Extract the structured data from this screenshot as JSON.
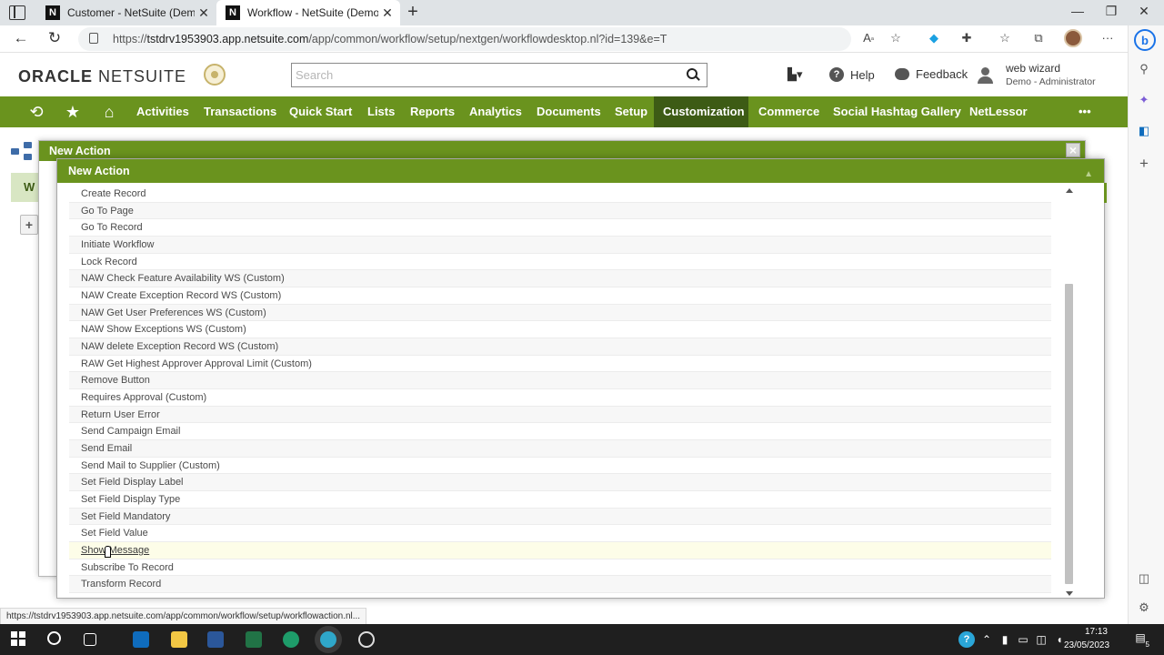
{
  "browser": {
    "tabs": [
      {
        "title": "Customer - NetSuite (Demo)",
        "favicon": "N"
      },
      {
        "title": "Workflow - NetSuite (Demo)",
        "favicon": "N"
      }
    ],
    "url_prefix": "https://",
    "url_host": "tstdrv1953903.app.netsuite.com",
    "url_path": "/app/common/workflow/setup/nextgen/workflowdesktop.nl?id=139&e=T",
    "bing_label": "b"
  },
  "header": {
    "logo_oracle": "ORACLE",
    "logo_netsuite": "NETSUITE",
    "search_placeholder": "Search",
    "help_label": "Help",
    "feedback_label": "Feedback",
    "user_name": "web wizard",
    "user_role": "Demo - Administrator"
  },
  "nav": {
    "items": [
      "Activities",
      "Transactions",
      "Quick Start",
      "Lists",
      "Reports",
      "Analytics",
      "Documents",
      "Setup",
      "Customization",
      "Commerce",
      "Social Hashtag Gallery",
      "NetLessor"
    ],
    "active": "Customization",
    "more": "•••"
  },
  "background": {
    "strip_letter": "W",
    "plus": "+"
  },
  "modal_outer": {
    "title": "New Action",
    "close": "×"
  },
  "modal_inner": {
    "title": "New Action",
    "collapse": "▲",
    "actions": [
      "Create Record",
      "Go To Page",
      "Go To Record",
      "Initiate Workflow",
      "Lock Record",
      "NAW Check Feature Availability WS (Custom)",
      "NAW Create Exception Record WS (Custom)",
      "NAW Get User Preferences WS (Custom)",
      "NAW Show Exceptions WS (Custom)",
      "NAW delete Exception Record WS (Custom)",
      "RAW Get Highest Approver Approval Limit (Custom)",
      "Remove Button",
      "Requires Approval (Custom)",
      "Return User Error",
      "Send Campaign Email",
      "Send Email",
      "Send Mail to Supplier (Custom)",
      "Set Field Display Label",
      "Set Field Display Type",
      "Set Field Mandatory",
      "Set Field Value",
      "Show Message",
      "Subscribe To Record",
      "Transform Record"
    ],
    "hovered_index": 21
  },
  "status_url": "https://tstdrv1953903.app.netsuite.com/app/common/workflow/setup/workflowaction.nl...",
  "taskbar": {
    "time": "17:13",
    "date": "23/05/2023",
    "notifications": "5"
  },
  "colors": {
    "ns_green": "#6a931e",
    "ns_green_dark": "#3d5b15"
  }
}
